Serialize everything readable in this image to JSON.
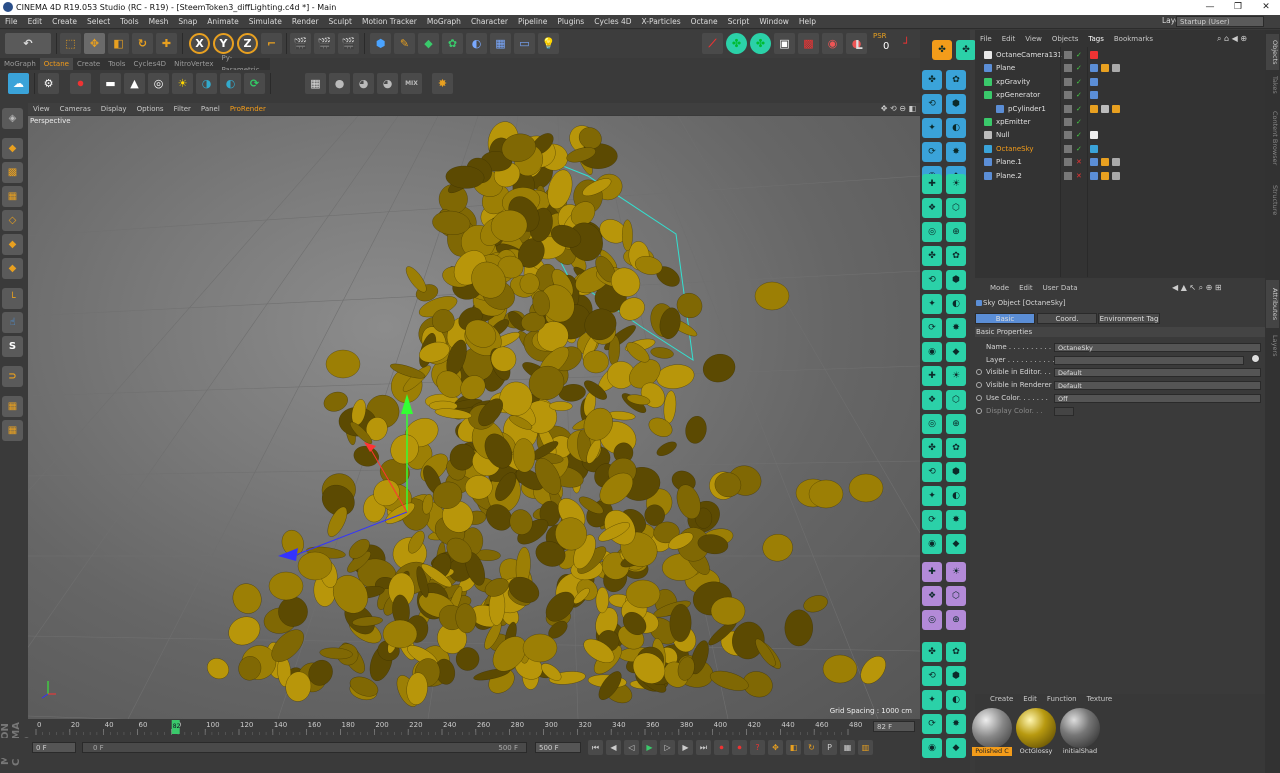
{
  "window": {
    "title": "CINEMA 4D R19.053 Studio (RC - R19) - [SteemToken3_diffLighting.c4d *] - Main",
    "minimize": "—",
    "maximize": "❐",
    "close": "✕"
  },
  "menu": {
    "items": [
      "File",
      "Edit",
      "Create",
      "Select",
      "Tools",
      "Mesh",
      "Snap",
      "Animate",
      "Simulate",
      "Render",
      "Sculpt",
      "Motion Tracker",
      "MoGraph",
      "Character",
      "Pipeline",
      "Plugins",
      "Cycles 4D",
      "X-Particles",
      "Octane",
      "Script",
      "Window",
      "Help"
    ],
    "layout_label": "Layout:",
    "layout_value": "Startup (User)"
  },
  "toolbar": {
    "x_label": "X",
    "y_label": "Y",
    "z_label": "Z",
    "l_label": "L",
    "psr_label": "PSR",
    "psr_value": "0"
  },
  "octane_tabs": [
    "MoGraph",
    "Octane",
    "Create",
    "Tools",
    "Cycles4D",
    "NitroVertex",
    "Py-Parametric"
  ],
  "octane_active_tab": "Octane",
  "viewport": {
    "menu": [
      "View",
      "Cameras",
      "Display",
      "Options",
      "Filter",
      "Panel",
      "ProRender"
    ],
    "mode": "Perspective",
    "grid_spacing": "Grid Spacing : 1000 cm"
  },
  "timeline": {
    "ticks": [
      "0",
      "20",
      "40",
      "60",
      "80",
      "100",
      "120",
      "140",
      "160",
      "180",
      "200",
      "220",
      "240",
      "260",
      "280",
      "300",
      "320",
      "340",
      "360",
      "380",
      "400",
      "420",
      "440",
      "460",
      "480"
    ],
    "current_frame_marker": "82",
    "end_frame": "82 F",
    "start_field": "0 F",
    "range_start": "0 F",
    "range_end": "500 F",
    "max_field": "500 F"
  },
  "object_manager": {
    "menu": [
      "File",
      "Edit",
      "View",
      "Objects",
      "Tags",
      "Bookmarks"
    ],
    "objects": [
      {
        "name": "OctaneCamera131",
        "color": "#e0e0e0"
      },
      {
        "name": "Plane",
        "color": "#e0e0e0"
      },
      {
        "name": "xpGravity",
        "color": "#e0e0e0"
      },
      {
        "name": "xpGenerator",
        "color": "#e0e0e0"
      },
      {
        "name": "pCylinder1",
        "color": "#e0e0e0"
      },
      {
        "name": "xpEmitter",
        "color": "#e0e0e0"
      },
      {
        "name": "Null",
        "color": "#e0e0e0"
      },
      {
        "name": "OctaneSky",
        "color": "#f39c1a"
      },
      {
        "name": "Plane.1",
        "color": "#e0e0e0"
      },
      {
        "name": "Plane.2",
        "color": "#e0e0e0"
      }
    ]
  },
  "attributes": {
    "menu": [
      "Mode",
      "Edit",
      "User Data"
    ],
    "object_title": "Sky Object [OctaneSky]",
    "tabs": [
      "Basic",
      "Coord.",
      "Environment Tag"
    ],
    "section": "Basic Properties",
    "fields": [
      {
        "label": "Name . . . . . . . . . . . .",
        "value": "OctaneSky"
      },
      {
        "label": "Layer . . . . . . . . . . . .",
        "value": ""
      },
      {
        "label": "Visible in Editor. . .",
        "value": "Default"
      },
      {
        "label": "Visible in Renderer",
        "value": "Default"
      },
      {
        "label": "Use Color. . . . . . .",
        "value": "Off"
      },
      {
        "label": "Display Color. . .",
        "value": ""
      }
    ]
  },
  "materials": {
    "menu": [
      "Create",
      "Edit",
      "Function",
      "Texture"
    ],
    "items": [
      {
        "name": "Polished C",
        "selected": true
      },
      {
        "name": "OctGlossy",
        "selected": false
      },
      {
        "name": "initialShad",
        "selected": false
      }
    ]
  },
  "right_tabs": [
    "Objects",
    "Takes",
    "Content Browser",
    "Structure",
    "Attributes",
    "Layers"
  ],
  "branding": "MAXON CINEMA 4D"
}
